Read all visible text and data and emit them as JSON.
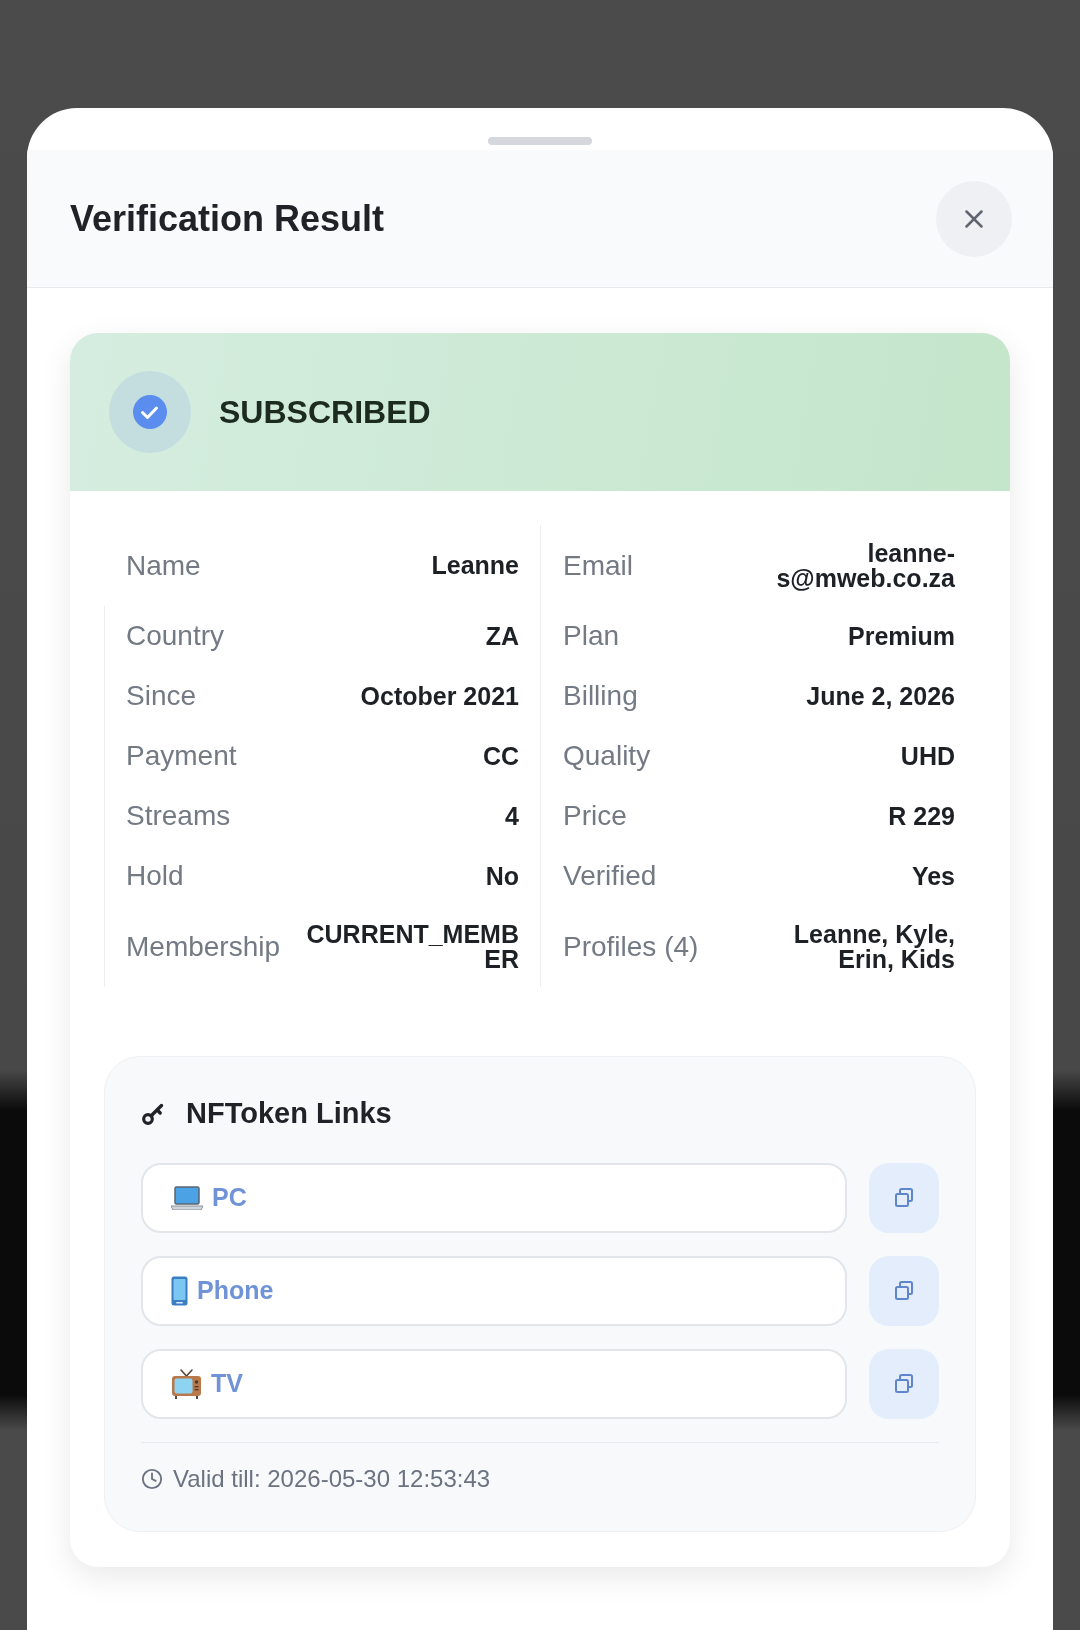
{
  "sheet": {
    "title": "Verification Result"
  },
  "status": {
    "label": "SUBSCRIBED"
  },
  "details": {
    "rows": [
      [
        {
          "label": "Name",
          "value": "Leanne"
        },
        {
          "label": "Email",
          "value": "leanne-s@mweb.co.za"
        }
      ],
      [
        {
          "label": "Country",
          "value": "ZA"
        },
        {
          "label": "Plan",
          "value": "Premium"
        }
      ],
      [
        {
          "label": "Since",
          "value": "October 2021"
        },
        {
          "label": "Billing",
          "value": "June 2, 2026"
        }
      ],
      [
        {
          "label": "Payment",
          "value": "CC"
        },
        {
          "label": "Quality",
          "value": "UHD"
        }
      ],
      [
        {
          "label": "Streams",
          "value": "4"
        },
        {
          "label": "Price",
          "value": "R 229"
        }
      ],
      [
        {
          "label": "Hold",
          "value": "No"
        },
        {
          "label": "Verified",
          "value": "Yes"
        }
      ],
      [
        {
          "label": "Membership",
          "value": "CURRENT_MEMBER"
        },
        {
          "label": "Profiles (4)",
          "value": "Leanne, Kyle, Erin, Kids"
        }
      ]
    ]
  },
  "nftoken": {
    "title": "NFToken Links",
    "links": [
      {
        "kind": "laptop",
        "label": "PC"
      },
      {
        "kind": "phone",
        "label": "Phone"
      },
      {
        "kind": "tv",
        "label": "TV"
      }
    ],
    "valid_till": "Valid till: 2026-05-30 12:53:43"
  }
}
